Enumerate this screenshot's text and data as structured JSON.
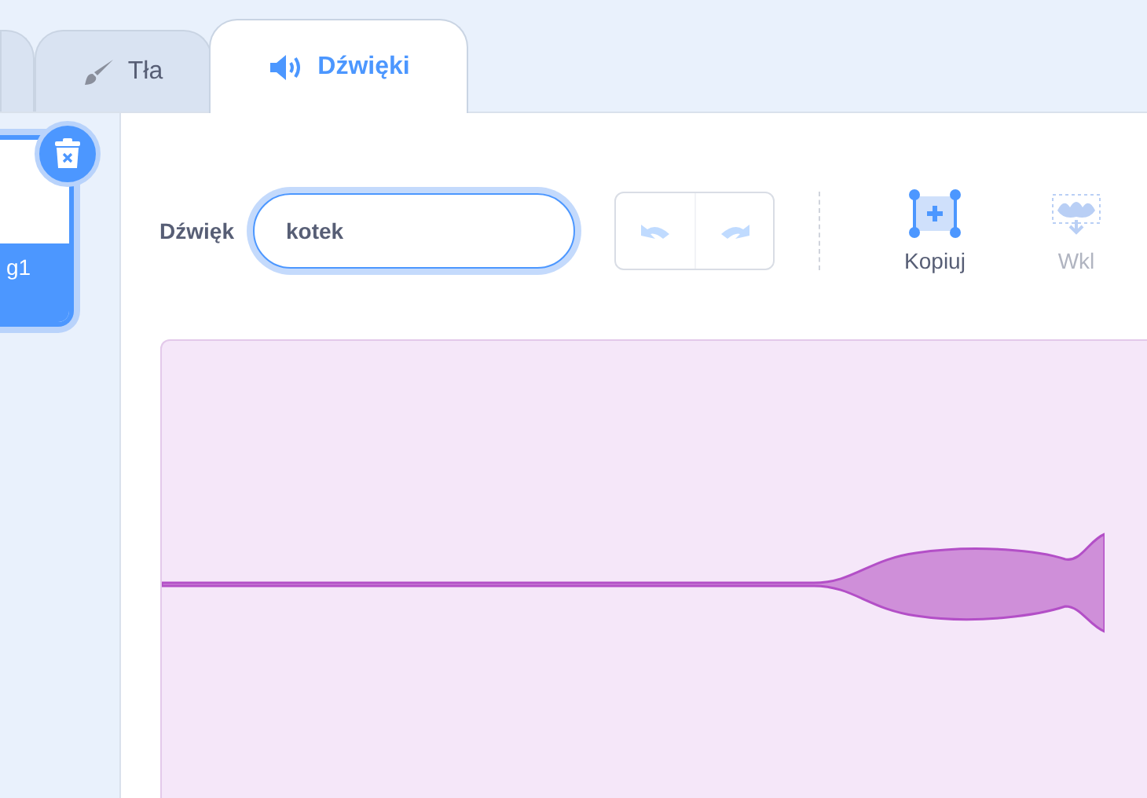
{
  "tabs": [
    {
      "kind": "partial",
      "selected": false
    },
    {
      "label": "Tła",
      "kind": "brush",
      "selected": false
    },
    {
      "label": "Dźwięki",
      "kind": "speaker",
      "selected": true
    }
  ],
  "sidebar": {
    "items": [
      {
        "label": "g1",
        "selected": true
      }
    ]
  },
  "editor": {
    "name_label": "Dźwięk",
    "name_value": "kotek",
    "history_buttons": [
      {
        "kind": "undo",
        "disabled": true
      },
      {
        "kind": "redo",
        "disabled": true
      }
    ],
    "tools": [
      {
        "kind": "copy",
        "label": "Kopiuj",
        "disabled": false
      },
      {
        "kind": "paste",
        "label": "Wkl",
        "disabled": true
      }
    ]
  }
}
